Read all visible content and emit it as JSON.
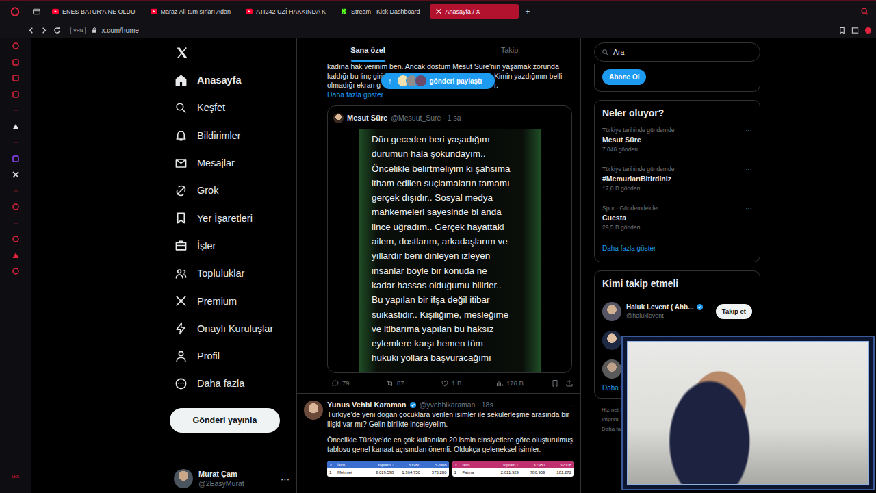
{
  "browser": {
    "tabs": [
      {
        "label": "ENES BATUR'A NE OLDU",
        "kind": "youtube",
        "selected": false
      },
      {
        "label": "Maraz Ali tüm sırları Adan",
        "kind": "youtube",
        "selected": false
      },
      {
        "label": "ATI242 UZİ HAKKINDA K",
        "kind": "youtube",
        "selected": false
      },
      {
        "label": "Stream - Kick Dashboard",
        "kind": "kick",
        "selected": false
      },
      {
        "label": "Anasayfa / X",
        "kind": "x",
        "selected": true
      }
    ],
    "new_tab": "+",
    "vpn": "VPN",
    "url": "x.com/home",
    "sidebar_footer": "GX"
  },
  "nav": {
    "items": [
      {
        "label": "Anasayfa",
        "kind": "home",
        "selected": true
      },
      {
        "label": "Keşfet",
        "kind": "search",
        "selected": false
      },
      {
        "label": "Bildirimler",
        "kind": "bell",
        "selected": false
      },
      {
        "label": "Mesajlar",
        "kind": "mail",
        "selected": false
      },
      {
        "label": "Grok",
        "kind": "grok",
        "selected": false
      },
      {
        "label": "Yer İşaretleri",
        "kind": "bookmark",
        "selected": false
      },
      {
        "label": "İşler",
        "kind": "briefcase",
        "selected": false
      },
      {
        "label": "Topluluklar",
        "kind": "people",
        "selected": false
      },
      {
        "label": "Premium",
        "kind": "x",
        "selected": false
      },
      {
        "label": "Onaylı Kuruluşlar",
        "kind": "bolt",
        "selected": false
      },
      {
        "label": "Profil",
        "kind": "person",
        "selected": false
      },
      {
        "label": "Daha fazla",
        "kind": "more",
        "selected": false
      }
    ],
    "post_button": "Gönderi yayınla",
    "account": {
      "name": "Murat Çam",
      "handle": "@2EasyMurat",
      "more": "···"
    }
  },
  "feed": {
    "tabs": [
      {
        "label": "Sana özel",
        "selected": true
      },
      {
        "label": "Takip",
        "selected": false
      }
    ],
    "new_posts": {
      "arrow": "↑",
      "label": "gönderi paylaştı"
    },
    "quote_post": {
      "text_lines": [
        {
          "left": "kadına hak verinim ben. Ancak dostum Mesut Süre'nin yaşamak zorunda",
          "right": ""
        },
        {
          "left": "kaldığı bu linç giri",
          "right": "Kimin yazdığının belli"
        },
        {
          "left": "olmadığı ekran g",
          "right": "r."
        }
      ],
      "show_more": "Daha fazla göster",
      "quoted": {
        "name": "Mesut Süre",
        "meta": "@Mesuut_Sure · 1 sa",
        "image_lines": [
          "Dün geceden beri yaşadığım",
          "durumun hala şokundayım..",
          "Öncelikle belirtmeliyim ki şahsıma",
          "itham edilen suçlamaların tamamı",
          "gerçek dışıdır.. Sosyal medya",
          "mahkemeleri sayesinde bi anda",
          "lince uğradım.. Gerçek hayattaki",
          "ailem, dostlarım, arkadaşlarım ve",
          "yıllardır beni dinleyen izleyen",
          "insanlar böyle bir konuda ne",
          "kadar hassas olduğumu bilirler..",
          "Bu yapılan bir ifşa değil itibar",
          "suikastidir.. Kişiliğime, mesleğime",
          "ve itibarıma yapılan bu haksız",
          "eylemlere karşı hemen tüm",
          "hukuki yollara başvuracağımı"
        ]
      },
      "stats": {
        "replies": "79",
        "reposts": "87",
        "likes": "1 B",
        "views": "176 B"
      }
    },
    "post": {
      "name": "Yunus Vehbi Karaman",
      "verified": true,
      "meta": "@yvehbikaraman · 18s",
      "more": "···",
      "paragraphs": [
        "Türkiye'de yeni doğan çocuklara verilen isimler ile sekülerleşme arasında bir ilişki var mı? Gelin birlikte inceleyelim.",
        "Öncelikle Türkiye'de en çok kullanılan 20 ismin cinsiyetlere göre oluşturulmuş tablosu genel kanaat açısından önemli. Oldukça geleneksel isimler."
      ],
      "tables": [
        {
          "symbol": "♂",
          "color": "#3a6fd0",
          "columns": [
            "İsim",
            "toplam ↓",
            ">1980",
            ">2008"
          ],
          "row": [
            "1",
            "Mehmet",
            "3.619.598",
            "1.364.750",
            "375.280"
          ]
        },
        {
          "symbol": "♀",
          "color": "#c0306e",
          "columns": [
            "İsim",
            "toplam ↓",
            ">1980",
            ">2008"
          ],
          "row": [
            "1",
            "Fatma",
            "2.611.929",
            "786.909",
            "181.272"
          ]
        }
      ]
    }
  },
  "sidebar": {
    "search": {
      "placeholder": "Ara"
    },
    "subscribe": "Abone Ol",
    "trends": {
      "title": "Neler oluyor?",
      "items": [
        {
          "context": "Türkiye tarihinde gündemde",
          "name": "Mesut Süre",
          "count": "7.046 gönderi",
          "more": "···"
        },
        {
          "context": "Türkiye tarihinde gündemde",
          "name": "#MemurlarıBitirdiniz",
          "count": "17,8 B gönderi",
          "more": "···"
        },
        {
          "context": "Spor · Gündemdekiler",
          "name": "Cuesta",
          "count": "29,5 B gönderi",
          "more": "···"
        }
      ],
      "show_more": "Daha fazla göster"
    },
    "follow": {
      "title": "Kimi takip etmeli",
      "items": [
        {
          "name": "Haluk Levent ( Ahb...",
          "handle": "@haluklevent",
          "verified": true,
          "button": "Takip et"
        }
      ],
      "show_more": "Daha f"
    },
    "footer": [
      "Hizmet Ş",
      "Imprint",
      "Daha fa"
    ]
  }
}
